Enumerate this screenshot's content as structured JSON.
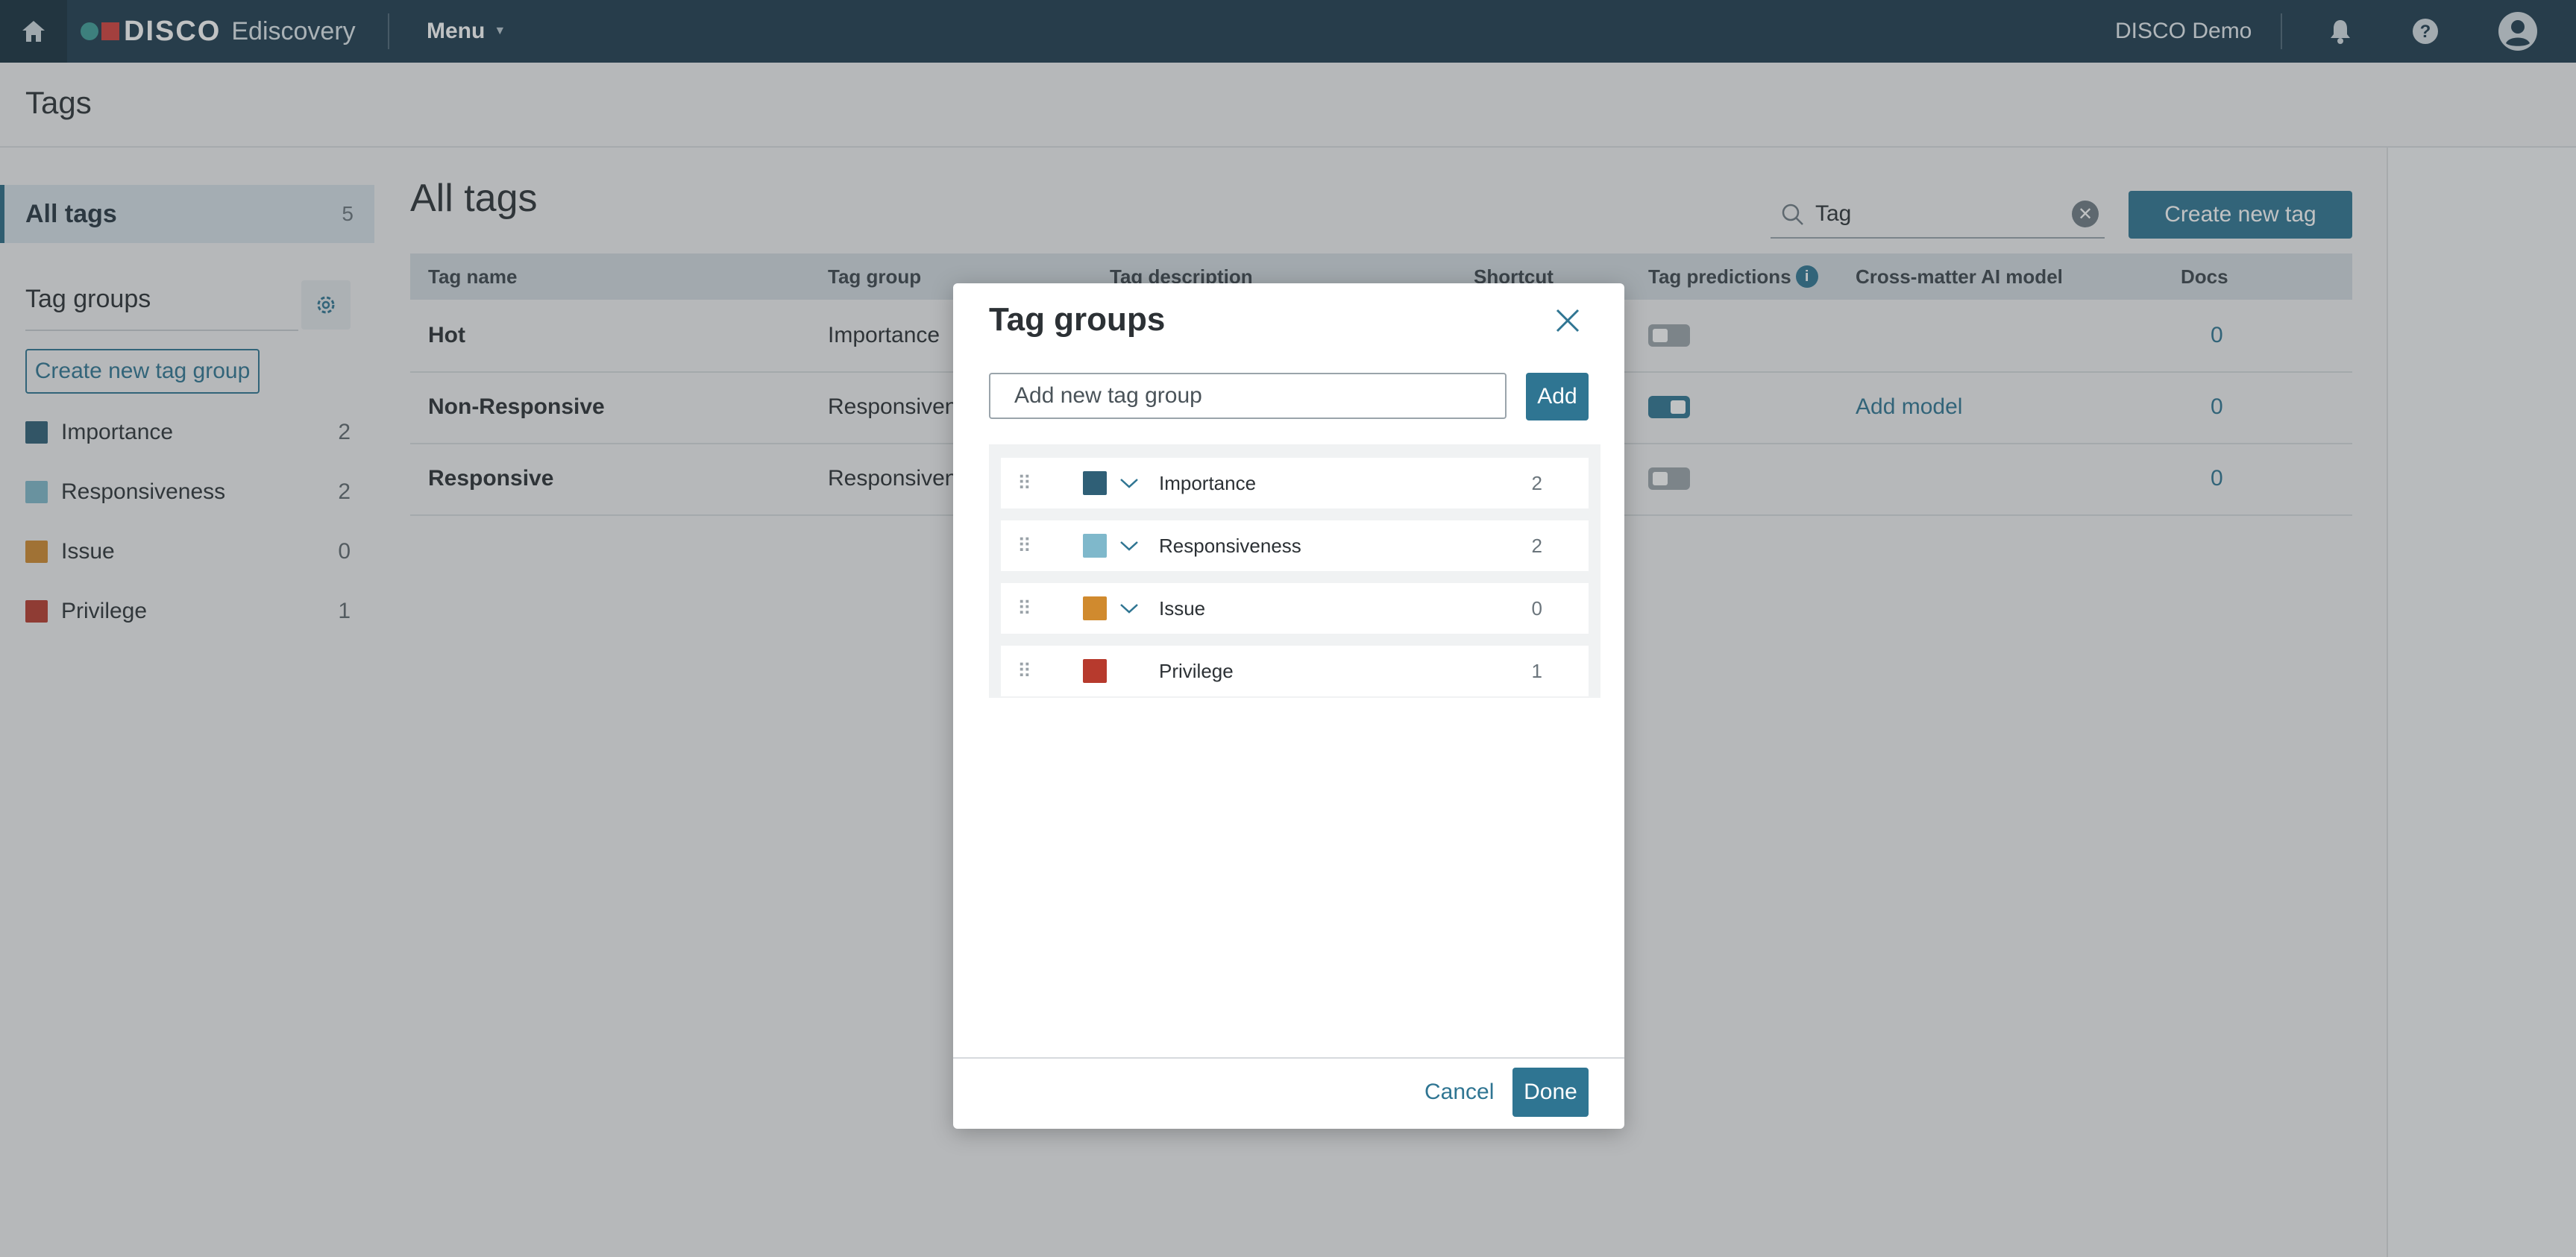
{
  "topbar": {
    "brand": "DISCO",
    "product": "Ediscovery",
    "menu_label": "Menu",
    "user_name": "DISCO Demo",
    "icons": [
      "home-icon",
      "bell-icon",
      "help-icon",
      "user-icon"
    ],
    "bg_color": "#1e3b4f"
  },
  "page": {
    "title": "Tags"
  },
  "sidebar": {
    "all_tags_label": "All tags",
    "all_tags_count": "5",
    "groups_title": "Tag groups",
    "create_group_label": "Create new tag group",
    "groups": [
      {
        "name": "Importance",
        "count": "2",
        "color": "#2f5f76"
      },
      {
        "name": "Responsiveness",
        "count": "2",
        "color": "#7fb8cb"
      },
      {
        "name": "Issue",
        "count": "0",
        "color": "#d08a2e"
      },
      {
        "name": "Privilege",
        "count": "1",
        "color": "#b73a2d"
      }
    ]
  },
  "main": {
    "title": "All tags",
    "search_value": "Tag",
    "create_tag_label": "Create new tag",
    "columns": [
      "Tag name",
      "Tag group",
      "Tag description",
      "Shortcut",
      "Tag predictions",
      "Cross-matter AI model",
      "Docs"
    ],
    "rows": [
      {
        "name": "Hot",
        "group": "Importance",
        "prediction_on": false,
        "ai_model": "",
        "docs": "0"
      },
      {
        "name": "Non-Responsive",
        "group": "Responsiveness",
        "prediction_on": true,
        "ai_model": "Add model",
        "docs": "0"
      },
      {
        "name": "Responsive",
        "group": "Responsiveness",
        "prediction_on": false,
        "ai_model": "",
        "docs": "0"
      }
    ]
  },
  "modal": {
    "title": "Tag groups",
    "input_placeholder": "Add new tag group",
    "add_label": "Add",
    "groups": [
      {
        "name": "Importance",
        "count": "2",
        "color": "#2f5f76",
        "expandable": true
      },
      {
        "name": "Responsiveness",
        "count": "2",
        "color": "#7fb8cb",
        "expandable": true
      },
      {
        "name": "Issue",
        "count": "0",
        "color": "#d08a2e",
        "expandable": true
      },
      {
        "name": "Privilege",
        "count": "1",
        "color": "#b73a2d",
        "expandable": false
      }
    ],
    "cancel_label": "Cancel",
    "done_label": "Done"
  },
  "colors": {
    "accent": "#2f7592"
  }
}
